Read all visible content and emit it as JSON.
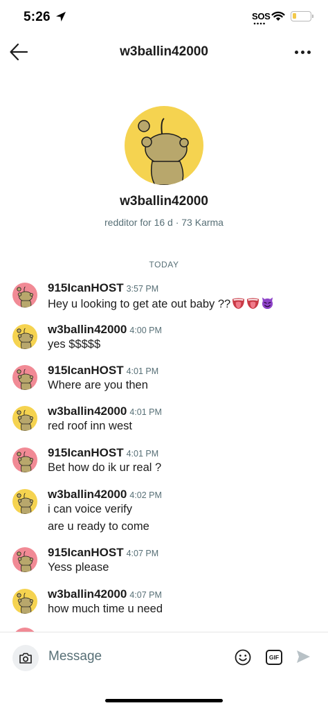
{
  "status_bar": {
    "time": "5:26",
    "sos": "SOS",
    "battery_level": 0.2
  },
  "header": {
    "title": "w3ballin42000"
  },
  "profile": {
    "username": "w3ballin42000",
    "meta": "redditor for 16 d · 73 Karma"
  },
  "conversation": {
    "date_label": "TODAY",
    "messages": [
      {
        "author": "915IcanHOST",
        "time": "3:57 PM",
        "text": "Hey u looking to get ate out baby ??",
        "avatar": "pink",
        "emojis": [
          "tongue-emoji",
          "tongue-emoji",
          "devil-emoji"
        ]
      },
      {
        "author": "w3ballin42000",
        "time": "4:00 PM",
        "text": "yes $$$$$",
        "avatar": "yellow"
      },
      {
        "author": "915IcanHOST",
        "time": "4:01 PM",
        "text": "Where are you then",
        "avatar": "pink"
      },
      {
        "author": "w3ballin42000",
        "time": "4:01 PM",
        "text": "red roof inn west",
        "avatar": "yellow"
      },
      {
        "author": "915IcanHOST",
        "time": "4:01 PM",
        "text": "Bet how do ik ur real ?",
        "avatar": "pink"
      },
      {
        "author": "w3ballin42000",
        "time": "4:02 PM",
        "text": "i can voice verify",
        "text2": "are u ready to come",
        "avatar": "yellow"
      },
      {
        "author": "915IcanHOST",
        "time": "4:07 PM",
        "text": "Yess please",
        "avatar": "pink"
      },
      {
        "author": "w3ballin42000",
        "time": "4:07 PM",
        "text": "how much time u need",
        "avatar": "yellow"
      }
    ]
  },
  "composer": {
    "placeholder": "Message",
    "gif_label": "GIF"
  },
  "colors": {
    "pink_avatar": "#f18a95",
    "yellow_avatar": "#f5d350",
    "meta_text": "#576f76"
  }
}
